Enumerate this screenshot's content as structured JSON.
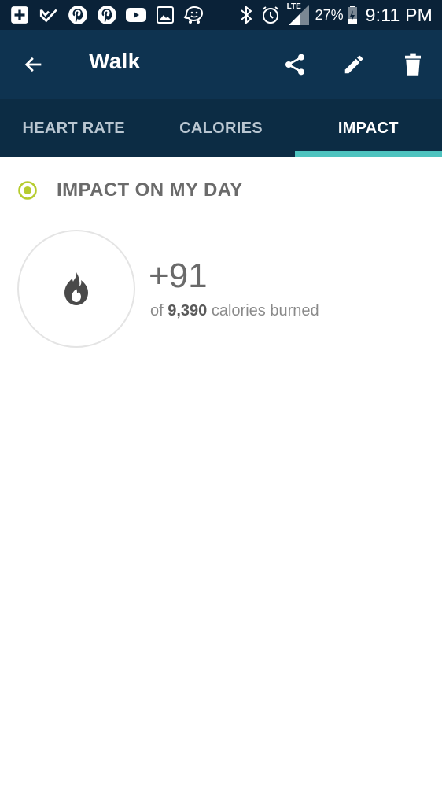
{
  "status_bar": {
    "battery_percent": "27%",
    "time": "9:11 PM",
    "network": "LTE",
    "notification_icons": [
      "add-box-icon",
      "check-icon",
      "pinterest-icon",
      "pinterest-icon",
      "youtube-icon",
      "image-icon",
      "waze-icon"
    ],
    "system_icons": [
      "bluetooth-icon",
      "alarm-icon",
      "signal-icon",
      "battery-icon"
    ]
  },
  "toolbar": {
    "title": "Walk",
    "actions": [
      "share-icon",
      "edit-icon",
      "delete-icon"
    ]
  },
  "tabs": [
    {
      "label": "HEART RATE",
      "active": false
    },
    {
      "label": "CALORIES",
      "active": false
    },
    {
      "label": "IMPACT",
      "active": true
    }
  ],
  "impact": {
    "section_title": "IMPACT ON MY DAY",
    "value": "+91",
    "sub_prefix": "of ",
    "sub_total": "9,390",
    "sub_suffix": " calories burned"
  },
  "colors": {
    "status_bar": "#0a2238",
    "toolbar": "#0e3350",
    "tabs": "#0c2c44",
    "tab_indicator": "#4ec3bf",
    "radio_accent": "#b6cc2e"
  }
}
